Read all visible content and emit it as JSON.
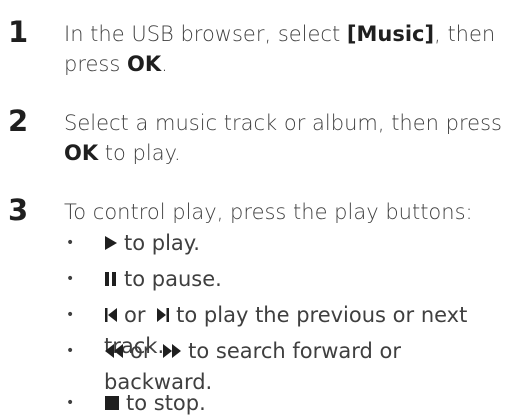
{
  "steps": [
    {
      "number": "1",
      "pre": "In the USB browser, select ",
      "highlight": "[Music]",
      "mid": ", then press ",
      "key": "OK",
      "post": "."
    },
    {
      "number": "2",
      "pre": "Select a music track or album, then press ",
      "key": "OK",
      "post": " to play."
    },
    {
      "number": "3",
      "text": "To control play, press the play buttons:"
    }
  ],
  "bullets": [
    {
      "bullet": "•",
      "icon": "play-icon",
      "text": "to play."
    },
    {
      "bullet": "•",
      "icon": "pause-icon",
      "text": "to pause."
    },
    {
      "bullet": "•",
      "icon": "previous-icon",
      "or": "or",
      "icon2": "next-icon",
      "text": "to play the previous or next track."
    },
    {
      "bullet": "•",
      "icon": "rewind-icon",
      "or": "or",
      "icon2": "fast-forward-icon",
      "text": "to search forward or backward."
    },
    {
      "bullet": "•",
      "icon": "stop-icon",
      "text": "to stop."
    }
  ],
  "colors": {
    "text": "#3f3f3f",
    "bold": "#1f1f1f"
  }
}
